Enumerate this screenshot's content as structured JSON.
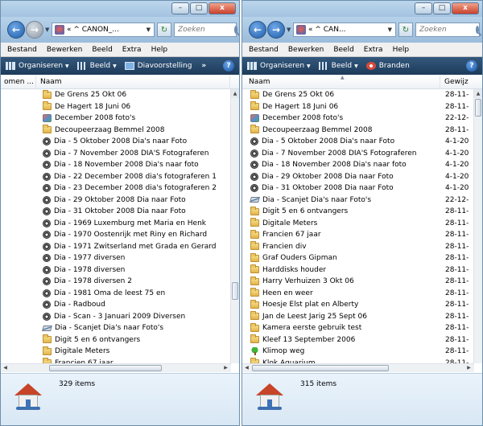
{
  "colors": {
    "toolbar": "#1e3b5a",
    "accent": "#1f5da8",
    "close": "#c9412b"
  },
  "window_buttons": {
    "minimize": "–",
    "maximize": "□",
    "close": "x"
  },
  "left": {
    "address": "« ^ CANON_...",
    "search_placeholder": "Zoeken",
    "menu": [
      "Bestand",
      "Bewerken",
      "Beeld",
      "Extra",
      "Help"
    ],
    "toolbar": [
      "Organiseren",
      "Beeld",
      "Diavoorstelling"
    ],
    "columns": [
      "omen ...",
      "Naam"
    ],
    "items": [
      {
        "icon": "folder-icon",
        "name": "De Grens 25 Okt 06"
      },
      {
        "icon": "folder-icon",
        "name": "De Hagert 18 Juni 06"
      },
      {
        "icon": "photo-album-icon",
        "name": "December 2008 foto's"
      },
      {
        "icon": "folder-icon",
        "name": "Decoupeerzaag Bemmel 2008"
      },
      {
        "icon": "slideshow-icon",
        "name": "Dia - 5 Oktober 2008 Dia's naar Foto"
      },
      {
        "icon": "slideshow-icon",
        "name": "Dia - 7 November 2008 DIA'S Fotograferen"
      },
      {
        "icon": "slideshow-icon",
        "name": "Dia - 18 November 2008 Dia's naar foto"
      },
      {
        "icon": "slideshow-icon",
        "name": "Dia - 22 December 2008 dia's fotograferen 1"
      },
      {
        "icon": "slideshow-icon",
        "name": "Dia - 23 December 2008 dia's fotograferen 2"
      },
      {
        "icon": "slideshow-icon",
        "name": "Dia - 29 Oktober 2008 Dia naar Foto"
      },
      {
        "icon": "slideshow-icon",
        "name": "Dia - 31 Oktober 2008 Dia naar Foto"
      },
      {
        "icon": "slideshow-icon",
        "name": "Dia - 1969 Luxemburg met Maria en Henk"
      },
      {
        "icon": "slideshow-icon",
        "name": "Dia - 1970 Oostenrijk met Riny en Richard"
      },
      {
        "icon": "slideshow-icon",
        "name": "Dia - 1971 Zwitserland met Grada en Gerard"
      },
      {
        "icon": "slideshow-icon",
        "name": "Dia - 1977 diversen"
      },
      {
        "icon": "slideshow-icon",
        "name": "Dia - 1978 diversen"
      },
      {
        "icon": "slideshow-icon",
        "name": "Dia - 1978 diversen 2"
      },
      {
        "icon": "slideshow-icon",
        "name": "Dia - 1981 Oma de leest 75 en"
      },
      {
        "icon": "slideshow-icon",
        "name": "Dia - Radboud"
      },
      {
        "icon": "slideshow-icon",
        "name": "Dia - Scan - 3 Januari 2009 Diversen"
      },
      {
        "icon": "scanner-icon",
        "name": "Dia - Scanjet Dia's naar Foto's"
      },
      {
        "icon": "folder-icon",
        "name": "Digit 5 en 6 ontvangers"
      },
      {
        "icon": "folder-icon",
        "name": "Digitale Meters"
      },
      {
        "icon": "folder-icon",
        "name": "Francien 67 jaar"
      }
    ],
    "item_count": "329 items"
  },
  "right": {
    "address": "« ^ CAN...",
    "search_placeholder": "Zoeken",
    "menu": [
      "Bestand",
      "Bewerken",
      "Beeld",
      "Extra",
      "Help"
    ],
    "toolbar": [
      "Organiseren",
      "Beeld",
      "Branden"
    ],
    "columns": [
      "Naam",
      "Gewijz"
    ],
    "items": [
      {
        "icon": "folder-icon",
        "name": "De Grens 25 Okt 06",
        "date": "28-11-"
      },
      {
        "icon": "folder-icon",
        "name": "De Hagert 18 Juni 06",
        "date": "28-11-"
      },
      {
        "icon": "photo-album-icon",
        "name": "December 2008 foto's",
        "date": "22-12-"
      },
      {
        "icon": "folder-icon",
        "name": "Decoupeerzaag Bemmel 2008",
        "date": "28-11-"
      },
      {
        "icon": "slideshow-icon",
        "name": "Dia - 5 Oktober 2008 Dia's naar Foto",
        "date": "4-1-20"
      },
      {
        "icon": "slideshow-icon",
        "name": "Dia - 7 November 2008 DIA'S Fotograferen",
        "date": "4-1-20"
      },
      {
        "icon": "slideshow-icon",
        "name": "Dia - 18 November 2008 Dia's naar foto",
        "date": "4-1-20"
      },
      {
        "icon": "slideshow-icon",
        "name": "Dia - 29 Oktober 2008 Dia naar Foto",
        "date": "4-1-20"
      },
      {
        "icon": "slideshow-icon",
        "name": "Dia - 31 Oktober 2008 Dia naar Foto",
        "date": "4-1-20"
      },
      {
        "icon": "scanner-icon",
        "name": "Dia - Scanjet Dia's naar Foto's",
        "date": "22-12-"
      },
      {
        "icon": "folder-icon",
        "name": "Digit 5 en 6 ontvangers",
        "date": "28-11-"
      },
      {
        "icon": "folder-icon",
        "name": "Digitale Meters",
        "date": "28-11-"
      },
      {
        "icon": "folder-icon",
        "name": "Francien 67 jaar",
        "date": "28-11-"
      },
      {
        "icon": "folder-icon",
        "name": "Francien div",
        "date": "28-11-"
      },
      {
        "icon": "folder-icon",
        "name": "Graf Ouders Gipman",
        "date": "28-11-"
      },
      {
        "icon": "folder-icon",
        "name": "Harddisks houder",
        "date": "28-11-"
      },
      {
        "icon": "folder-icon",
        "name": "Harry Verhuizen 3 Okt 06",
        "date": "28-11-"
      },
      {
        "icon": "folder-icon",
        "name": "Heen en weer",
        "date": "28-11-"
      },
      {
        "icon": "folder-icon",
        "name": "Hoesje Elst plat en Alberty",
        "date": "28-11-"
      },
      {
        "icon": "folder-icon",
        "name": "Jan de Leest Jarig 25 Sept 06",
        "date": "28-11-"
      },
      {
        "icon": "folder-icon",
        "name": "Kamera eerste gebruik test",
        "date": "28-11-"
      },
      {
        "icon": "folder-icon",
        "name": "Kleef 13 September 2006",
        "date": "28-11-"
      },
      {
        "icon": "tree-icon",
        "name": "Klimop weg",
        "date": "28-11-"
      },
      {
        "icon": "folder-icon",
        "name": "Klok Aquarium",
        "date": "28-11-"
      }
    ],
    "item_count": "315 items"
  }
}
